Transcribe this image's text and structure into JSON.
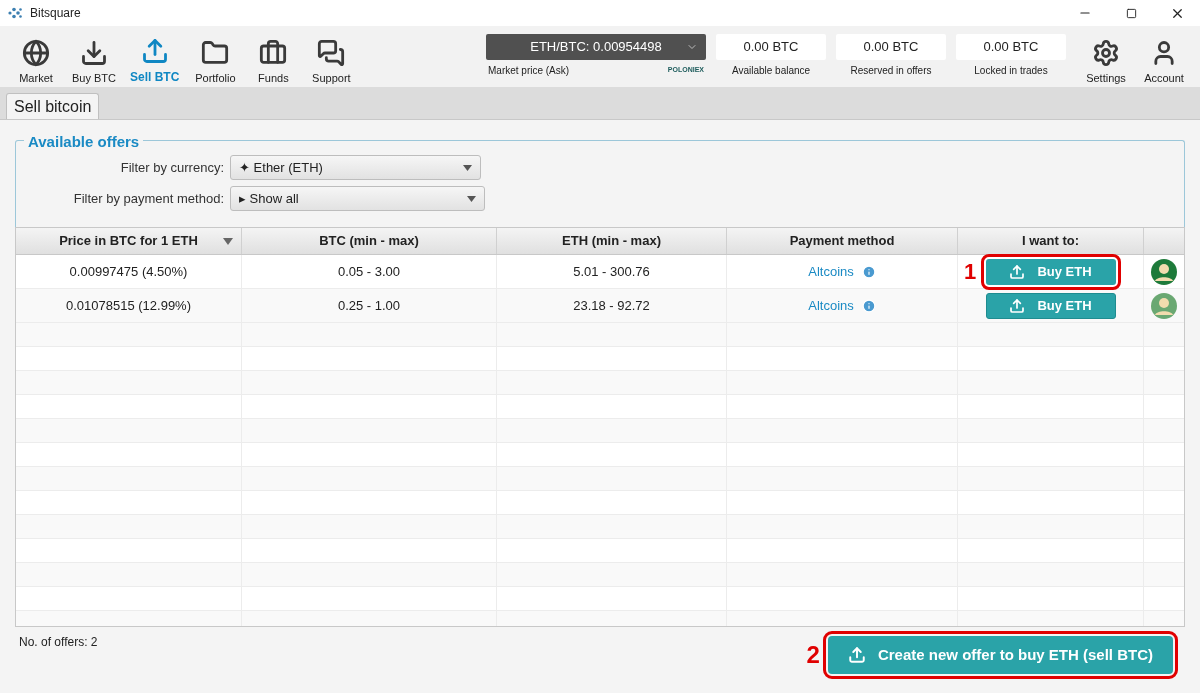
{
  "window": {
    "title": "Bitsquare"
  },
  "nav": [
    {
      "label": "Market",
      "selected": false
    },
    {
      "label": "Buy BTC",
      "selected": false
    },
    {
      "label": "Sell BTC",
      "selected": true
    },
    {
      "label": "Portfolio",
      "selected": false
    },
    {
      "label": "Funds",
      "selected": false
    },
    {
      "label": "Support",
      "selected": false
    }
  ],
  "market_price": {
    "value": "ETH/BTC: 0.00954498",
    "label": "Market price (Ask)",
    "provider": "POLONIEX"
  },
  "balances": [
    {
      "value": "0.00 BTC",
      "label": "Available balance"
    },
    {
      "value": "0.00 BTC",
      "label": "Reserved in offers"
    },
    {
      "value": "0.00 BTC",
      "label": "Locked in trades"
    }
  ],
  "nav_right": [
    {
      "label": "Settings"
    },
    {
      "label": "Account"
    }
  ],
  "tabs": [
    {
      "label": "Sell bitcoin",
      "selected": true
    }
  ],
  "offers": {
    "title": "Available offers",
    "filters": [
      {
        "label": "Filter by currency:",
        "value": "✦ Ether (ETH)"
      },
      {
        "label": "Filter by payment method:",
        "value": "▸ Show all"
      }
    ],
    "columns": [
      {
        "label": "Price in BTC for 1 ETH",
        "sorted": true
      },
      {
        "label": "BTC (min - max)",
        "sorted": false
      },
      {
        "label": "ETH (min - max)",
        "sorted": false
      },
      {
        "label": "Payment method",
        "sorted": false
      },
      {
        "label": "I want to:",
        "sorted": false
      }
    ],
    "rows": [
      {
        "price": "0.00997475 (4.50%)",
        "btc": "0.05 - 3.00",
        "eth": "5.01 - 300.76",
        "payment": "Altcoins",
        "action": "Buy ETH",
        "callout": "1",
        "color": "#1d7a3a"
      },
      {
        "price": "0.01078515 (12.99%)",
        "btc": "0.25 - 1.00",
        "eth": "23.18 - 92.72",
        "payment": "Altcoins",
        "action": "Buy ETH",
        "color": "#6aa872"
      }
    ],
    "count": "No. of offers: 2"
  },
  "create_button": {
    "label": "Create new offer to buy ETH (sell BTC)",
    "callout": "2"
  }
}
